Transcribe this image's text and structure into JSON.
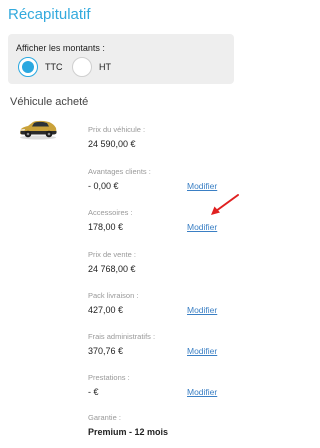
{
  "title": "Récapitulatif",
  "amounts": {
    "label": "Afficher les montants :",
    "options": [
      {
        "label": "TTC",
        "selected": true
      },
      {
        "label": "HT",
        "selected": false
      }
    ]
  },
  "vehicle": {
    "section_title": "Véhicule acheté",
    "image_icon": "car-icon",
    "fields": [
      {
        "label": "Prix du véhicule :",
        "value": "24 590,00 €",
        "modify": ""
      },
      {
        "label": "Avantages clients :",
        "value": "- 0,00 €",
        "modify": "Modifier"
      },
      {
        "label": "Accessoires :",
        "value": "178,00 €",
        "modify": "Modifier"
      },
      {
        "label": "Prix de vente :",
        "value": "24 768,00 €",
        "modify": ""
      },
      {
        "label": "Pack livraison :",
        "value": "427,00 €",
        "modify": "Modifier"
      },
      {
        "label": "Frais administratifs :",
        "value": "370,76 €",
        "modify": "Modifier"
      },
      {
        "label": "Prestations :",
        "value": "- €",
        "modify": "Modifier"
      },
      {
        "label": "Garantie :",
        "value": "Premium - 12 mois",
        "modify": ""
      }
    ]
  },
  "colors": {
    "accent": "#2aa8e0",
    "title": "#33aadd",
    "link": "#3a7fc4",
    "annotation_arrow": "#e02020"
  }
}
